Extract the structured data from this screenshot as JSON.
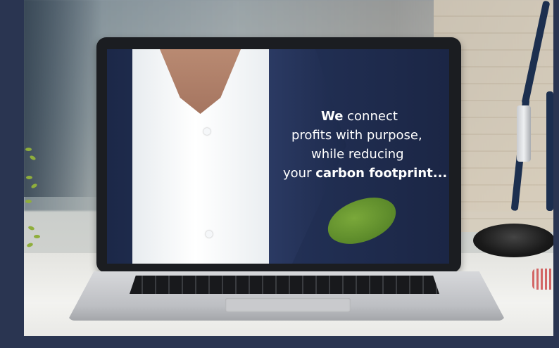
{
  "headline": {
    "line1_bold": "We",
    "line1_rest": " connect",
    "line2": "profits with purpose,",
    "line3": "while reducing",
    "line4_start": "your ",
    "line4_bold": "carbon footprint..."
  },
  "colors": {
    "frame": "#2a3551",
    "suit": "#24335a",
    "shirt": "#ffffff",
    "leaf": "#5f8f2c",
    "lamp": "#1c2f4f"
  },
  "icons": {
    "laptop": "laptop-icon",
    "lamp": "desk-lamp-icon",
    "plant": "plant-icon",
    "leaf": "leaf-icon"
  }
}
